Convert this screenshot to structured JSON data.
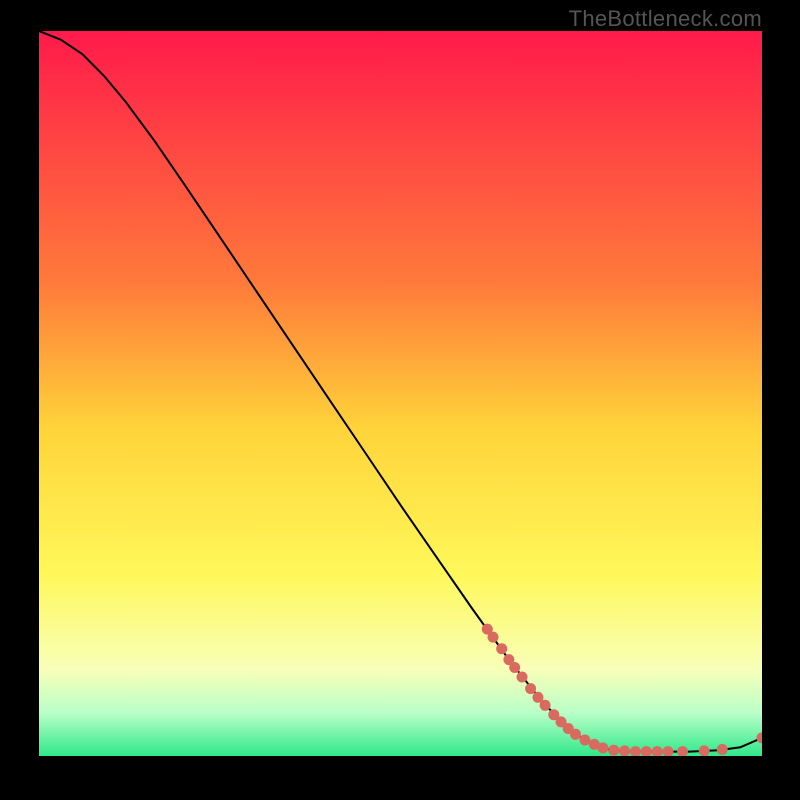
{
  "watermark": "TheBottleneck.com",
  "chart_data": {
    "type": "line",
    "title": "",
    "xlabel": "",
    "ylabel": "",
    "xlim": [
      0,
      100
    ],
    "ylim": [
      0,
      100
    ],
    "gradient_stops": [
      {
        "offset": 0,
        "color": "#ff1a4a"
      },
      {
        "offset": 35,
        "color": "#ff7b3a"
      },
      {
        "offset": 55,
        "color": "#ffd43a"
      },
      {
        "offset": 75,
        "color": "#fff85a"
      },
      {
        "offset": 88,
        "color": "#f8ffb8"
      },
      {
        "offset": 94,
        "color": "#baffc8"
      },
      {
        "offset": 100,
        "color": "#2fe88a"
      }
    ],
    "series": [
      {
        "name": "curve",
        "type": "line",
        "color": "#000000",
        "points": [
          {
            "x": 0.0,
            "y": 100.0
          },
          {
            "x": 3.0,
            "y": 98.8
          },
          {
            "x": 6.0,
            "y": 96.8
          },
          {
            "x": 9.0,
            "y": 93.8
          },
          {
            "x": 12.0,
            "y": 90.2
          },
          {
            "x": 16.0,
            "y": 84.8
          },
          {
            "x": 20.0,
            "y": 79.0
          },
          {
            "x": 25.0,
            "y": 71.6
          },
          {
            "x": 30.0,
            "y": 64.2
          },
          {
            "x": 35.0,
            "y": 56.8
          },
          {
            "x": 40.0,
            "y": 49.4
          },
          {
            "x": 45.0,
            "y": 42.0
          },
          {
            "x": 50.0,
            "y": 34.6
          },
          {
            "x": 55.0,
            "y": 27.4
          },
          {
            "x": 60.0,
            "y": 20.2
          },
          {
            "x": 65.0,
            "y": 13.3
          },
          {
            "x": 70.0,
            "y": 7.0
          },
          {
            "x": 75.0,
            "y": 2.5
          },
          {
            "x": 78.0,
            "y": 1.0
          },
          {
            "x": 82.0,
            "y": 0.6
          },
          {
            "x": 86.0,
            "y": 0.6
          },
          {
            "x": 90.0,
            "y": 0.6
          },
          {
            "x": 94.0,
            "y": 0.8
          },
          {
            "x": 97.0,
            "y": 1.2
          },
          {
            "x": 100.0,
            "y": 2.5
          }
        ]
      },
      {
        "name": "markers",
        "type": "scatter",
        "color": "#d96a5f",
        "points": [
          {
            "x": 62.0,
            "y": 17.5
          },
          {
            "x": 62.8,
            "y": 16.4
          },
          {
            "x": 64.0,
            "y": 14.8
          },
          {
            "x": 65.0,
            "y": 13.3
          },
          {
            "x": 65.8,
            "y": 12.2
          },
          {
            "x": 66.8,
            "y": 10.9
          },
          {
            "x": 68.0,
            "y": 9.3
          },
          {
            "x": 69.0,
            "y": 8.1
          },
          {
            "x": 70.0,
            "y": 7.0
          },
          {
            "x": 71.2,
            "y": 5.7
          },
          {
            "x": 72.2,
            "y": 4.7
          },
          {
            "x": 73.2,
            "y": 3.8
          },
          {
            "x": 74.2,
            "y": 3.0
          },
          {
            "x": 75.5,
            "y": 2.2
          },
          {
            "x": 76.8,
            "y": 1.6
          },
          {
            "x": 78.0,
            "y": 1.1
          },
          {
            "x": 79.5,
            "y": 0.8
          },
          {
            "x": 81.0,
            "y": 0.7
          },
          {
            "x": 82.5,
            "y": 0.6
          },
          {
            "x": 84.0,
            "y": 0.6
          },
          {
            "x": 85.5,
            "y": 0.6
          },
          {
            "x": 87.0,
            "y": 0.6
          },
          {
            "x": 89.0,
            "y": 0.6
          },
          {
            "x": 92.0,
            "y": 0.7
          },
          {
            "x": 94.5,
            "y": 0.9
          },
          {
            "x": 100.0,
            "y": 2.5
          }
        ]
      }
    ]
  }
}
